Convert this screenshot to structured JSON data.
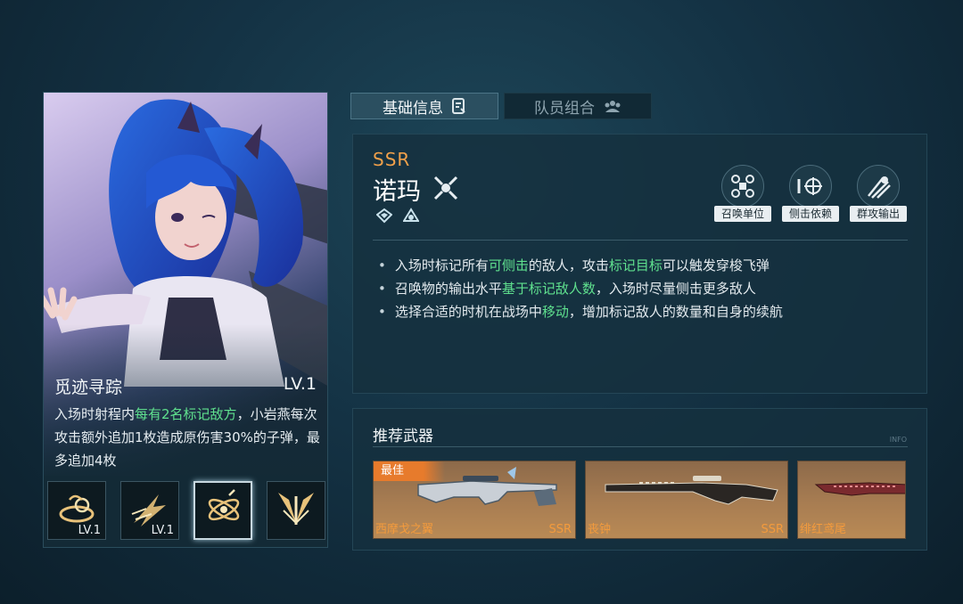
{
  "tabs": [
    {
      "label": "基础信息",
      "active": true
    },
    {
      "label": "队员组合",
      "active": false
    }
  ],
  "character": {
    "rarity": "SSR",
    "name": "诺玛"
  },
  "tags": [
    {
      "label": "召唤单位",
      "icon": "drone-icon"
    },
    {
      "label": "侧击依赖",
      "icon": "crosshair-icon"
    },
    {
      "label": "群攻输出",
      "icon": "burst-icon"
    }
  ],
  "traits": [
    {
      "before": "入场时标记所有",
      "hl1": "可侧击",
      "mid": "的敌人，攻击",
      "hl2": "标记目标",
      "after": "可以触发穿梭飞弹"
    },
    {
      "before": "召唤物的输出水平",
      "hl1": "基于标记敌人数",
      "mid": "，入场时尽量侧击更多敌人",
      "hl2": "",
      "after": ""
    },
    {
      "before": "选择合适的时机在战场中",
      "hl1": "移动",
      "mid": "，增加标记敌人的数量和自身的续航",
      "hl2": "",
      "after": ""
    }
  ],
  "skill": {
    "title": "觅迹寻踪",
    "level": "LV.1",
    "desc_1": "入场时射程内",
    "desc_hl": "每有2名标记敌方",
    "desc_2": "，小岩燕每次攻击额外追加1枚造成原伤害30%的子弹，最多追加4枚"
  },
  "skill_slots": [
    {
      "icon": "swirl-skill-icon",
      "level": "LV.1",
      "selected": false
    },
    {
      "icon": "dash-skill-icon",
      "level": "LV.1",
      "selected": false
    },
    {
      "icon": "orbit-skill-icon",
      "level": "",
      "selected": true
    },
    {
      "icon": "wings-skill-icon",
      "level": "",
      "selected": false
    }
  ],
  "weapons_title": "推荐武器",
  "weapons_marker": "INFO",
  "weapons": [
    {
      "name": "西摩戈之翼",
      "rarity": "SSR",
      "badge": "最佳"
    },
    {
      "name": "丧钟",
      "rarity": "SSR",
      "badge": ""
    },
    {
      "name": "绯红鸢尾",
      "rarity": "",
      "badge": ""
    }
  ]
}
